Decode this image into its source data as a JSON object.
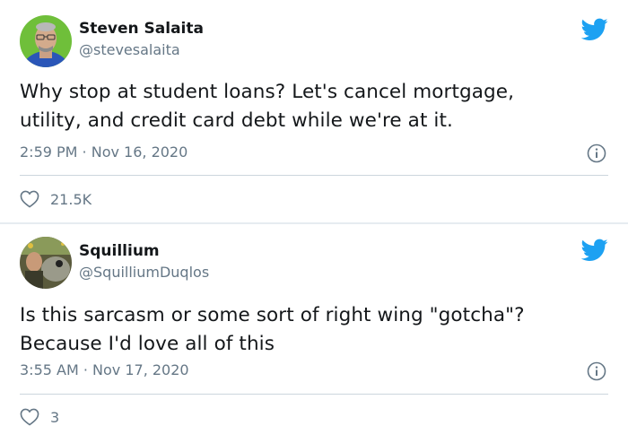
{
  "colors": {
    "twitter_blue": "#1da1f2",
    "secondary_text": "#657786",
    "primary_text": "#14171a",
    "divider": "#ccd6dd"
  },
  "tweets": [
    {
      "name": "Steven Salaita",
      "handle": "@stevesalaita",
      "text": "Why stop at student loans?  Let's cancel mortgage,\nutility, and credit card debt while we're at it.",
      "timestamp": "2:59 PM · Nov 16, 2020",
      "likes": "21.5K",
      "icons": {
        "brand": "twitter-bird-icon",
        "info": "info-icon",
        "like": "heart-icon"
      }
    },
    {
      "name": "Squillium",
      "handle": "@SquilliumDuqlos",
      "text": "Is this sarcasm or some sort of right wing \"gotcha\"?\nBecause I'd love all of this",
      "timestamp": "3:55 AM · Nov 17, 2020",
      "likes": "3",
      "icons": {
        "brand": "twitter-bird-icon",
        "info": "info-icon",
        "like": "heart-icon"
      }
    }
  ]
}
